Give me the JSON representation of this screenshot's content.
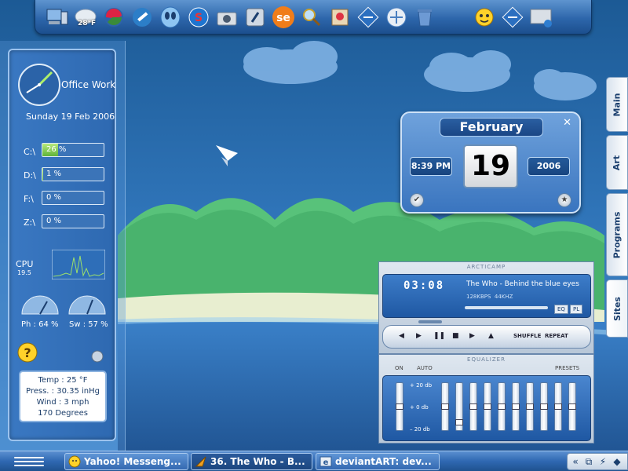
{
  "dock": {
    "weather_temp": "28°F",
    "icons": [
      "computer-icon",
      "weather-icon",
      "firefox-icon",
      "tools-icon",
      "alien-icon",
      "skype-icon",
      "camera-icon",
      "media-icon",
      "se-icon",
      "search-icon",
      "art-icon",
      "network-icon",
      "ie-icon",
      "recycle-bin-icon",
      "yahoo-icon",
      "network2-icon",
      "system-icon"
    ]
  },
  "sidebar": {
    "clock_label": "Office Work",
    "date": "Sunday 19 Feb 2006",
    "drives": [
      {
        "label": "C:\\",
        "value": "26 %",
        "percent": 26
      },
      {
        "label": "D:\\",
        "value": "1 %",
        "percent": 1
      },
      {
        "label": "F:\\",
        "value": "0 %",
        "percent": 0
      },
      {
        "label": "Z:\\",
        "value": "0 %",
        "percent": 0
      }
    ],
    "cpu_label": "CPU",
    "cpu_value": "19.5",
    "ph_label": "Ph : 64 %",
    "sw_label": "Sw : 57 %",
    "weather": {
      "temp": "Temp : 25 °F",
      "press": "Press. : 30.35 inHg",
      "wind": "Wind : 3 mph",
      "degrees": "170 Degrees"
    }
  },
  "calendar": {
    "month": "February",
    "time": "8:39 PM",
    "day": "19",
    "year": "2006"
  },
  "right_tabs": [
    "Main",
    "Art",
    "Programs",
    "Sites"
  ],
  "player": {
    "title": "ARCTICAMP",
    "time": "03:08",
    "song": "The Who - Behind the blue eyes",
    "kbps": "128KBPS",
    "khz": "44KHZ",
    "eq_btn": "EQ",
    "pl_btn": "PL",
    "shuffle": "SHUFFLE",
    "repeat": "REPEAT",
    "eq_title": "EQUALIZER",
    "on": "ON",
    "auto": "AUTO",
    "presets": "PRESETS",
    "db_plus": "+ 20 db",
    "db_zero": "+ 0 db",
    "db_minus": "– 20 db"
  },
  "taskbar": {
    "tasks": [
      {
        "label": "Yahoo! Messeng...",
        "icon": "yahoo-icon"
      },
      {
        "label": "36. The Who - B...",
        "icon": "winamp-icon"
      },
      {
        "label": "deviantART: dev...",
        "icon": "ie-icon"
      }
    ]
  }
}
